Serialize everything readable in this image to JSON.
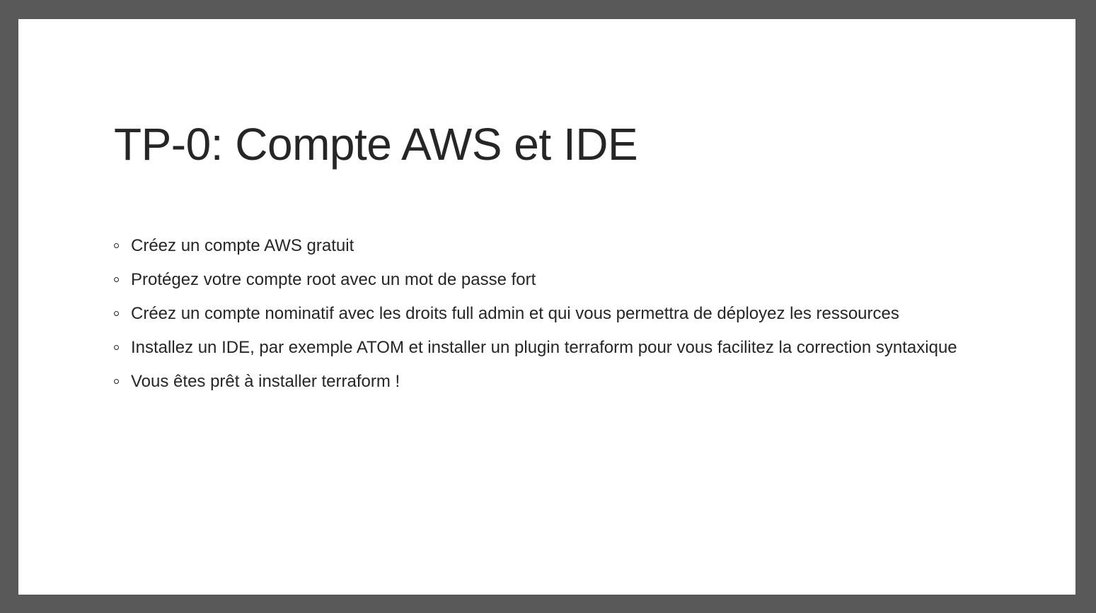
{
  "slide": {
    "title": "TP-0: Compte AWS et IDE",
    "bullets": [
      "Créez un compte AWS gratuit",
      "Protégez votre compte root avec un mot de passe fort",
      "Créez un compte nominatif avec les droits full admin et qui vous permettra de déployez les ressources",
      "Installez un IDE, par exemple ATOM et installer un plugin terraform pour vous facilitez la correction syntaxique",
      "Vous êtes prêt à installer terraform !"
    ],
    "bullet_icon": "hollow-circle-icon"
  },
  "colors": {
    "frame": "#595959",
    "background": "#ffffff",
    "text": "#262626"
  }
}
